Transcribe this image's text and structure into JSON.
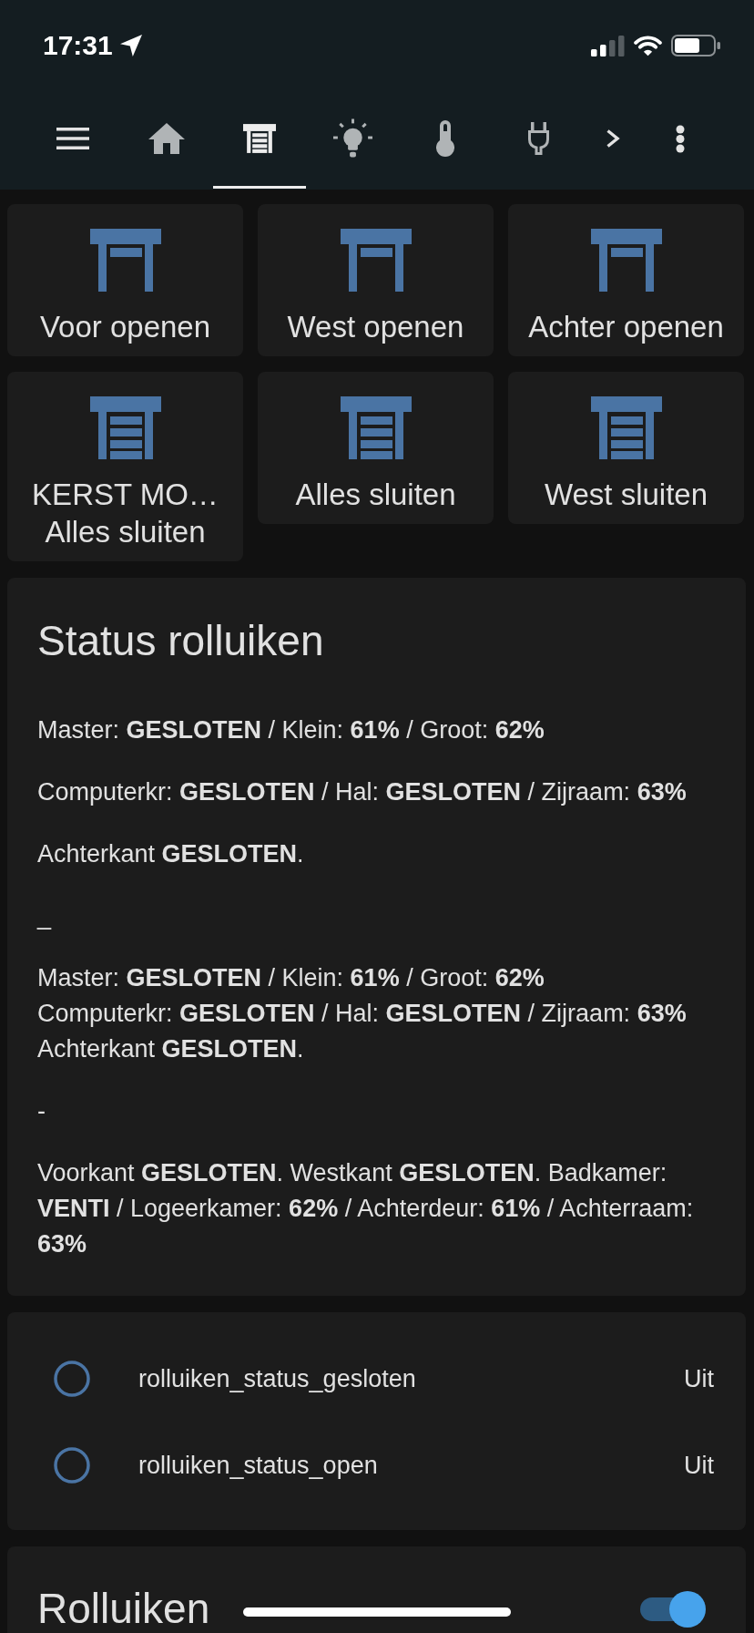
{
  "status_bar": {
    "time": "17:31"
  },
  "toolbar": {
    "tabs": [
      {
        "selected": false
      },
      {
        "selected": true
      },
      {
        "selected": false
      },
      {
        "selected": false
      },
      {
        "selected": false
      }
    ]
  },
  "buttons": [
    {
      "label": "Voor openen",
      "kind": "open"
    },
    {
      "label": "West openen",
      "kind": "open"
    },
    {
      "label": "Achter openen",
      "kind": "open"
    },
    {
      "label": "KERST MO…\nAlles sluiten",
      "kind": "closed"
    },
    {
      "label": "Alles sluiten",
      "kind": "closed"
    },
    {
      "label": "West sluiten",
      "kind": "closed"
    }
  ],
  "status_card": {
    "title": "Status rolluiken",
    "paragraphs": [
      "Master: **GESLOTEN** / Klein: **61%** / Groot: **62%**",
      "Computerkr: **GESLOTEN** / Hal: **GESLOTEN** / Zijraam: **63%**",
      "Achterkant **GESLOTEN**.",
      "_",
      "Master: **GESLOTEN** / Klein: **61%** / Groot: **62%**\nComputerkr: **GESLOTEN** / Hal: **GESLOTEN** / Zijraam: **63%**\nAchterkant **GESLOTEN**.",
      "-",
      "Voorkant **GESLOTEN**. Westkant **GESLOTEN**. Badkamer: **VENTI** / Logeerkamer: **62%** / Achterdeur: **61%** / Achterraam: **63%**"
    ]
  },
  "entities": [
    {
      "name": "rolluiken_status_gesloten",
      "state": "Uit",
      "on": false
    },
    {
      "name": "rolluiken_status_open",
      "state": "Uit",
      "on": false
    }
  ],
  "rolluiken_card": {
    "title": "Rolluiken",
    "toggle_on": true
  }
}
